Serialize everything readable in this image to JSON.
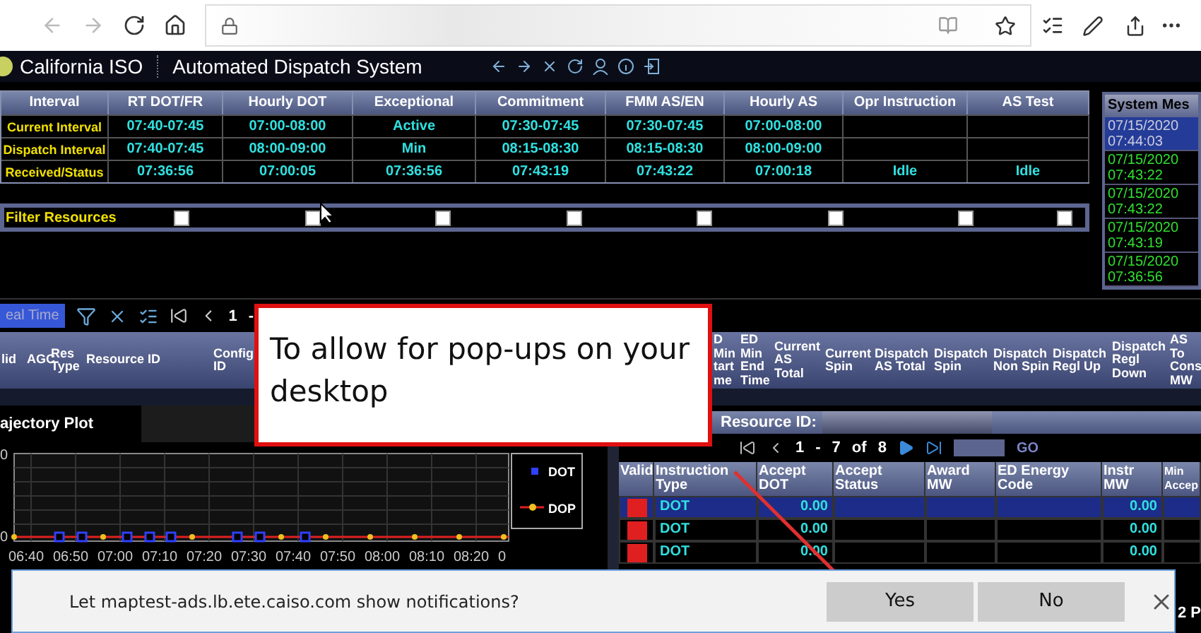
{
  "app": {
    "brand": "California ISO",
    "title": "Automated Dispatch System"
  },
  "interval_table": {
    "corner": "Interval",
    "columns": [
      "RT DOT/FR",
      "Hourly DOT",
      "Exceptional",
      "Commitment",
      "FMM AS/EN",
      "Hourly AS",
      "Opr Instruction",
      "AS Test"
    ],
    "rows": [
      {
        "label": "Current Interval",
        "cells": [
          "07:40-07:45",
          "07:00-08:00",
          "Active",
          "07:30-07:45",
          "07:30-07:45",
          "07:00-08:00"
        ]
      },
      {
        "label": "Dispatch Interval",
        "cells": [
          "07:40-07:45",
          "08:00-09:00",
          "Min",
          "08:15-08:30",
          "08:15-08:30",
          "08:00-09:00"
        ]
      },
      {
        "label": "Received/Status",
        "cells": [
          "07:36:56",
          "07:00:05",
          "07:36:56",
          "07:43:19",
          "07:43:22",
          "07:00:18",
          "Idle",
          "Idle"
        ]
      }
    ]
  },
  "filter": {
    "label": "Filter Resources",
    "checkboxes": [
      {
        "checked": false
      },
      {
        "checked": false
      },
      {
        "checked": false
      },
      {
        "checked": false
      },
      {
        "checked": false
      },
      {
        "checked": false
      },
      {
        "checked": false
      },
      {
        "checked": false
      }
    ]
  },
  "system_messages": {
    "title": "System Mes",
    "items": [
      {
        "date": "07/15/2020",
        "time": "07:44:03",
        "selected": true
      },
      {
        "date": "07/15/2020",
        "time": "07:43:22",
        "selected": false
      },
      {
        "date": "07/15/2020",
        "time": "07:43:22",
        "selected": false
      },
      {
        "date": "07/15/2020",
        "time": "07:43:19",
        "selected": false
      },
      {
        "date": "07/15/2020",
        "time": "07:36:56",
        "selected": false
      }
    ]
  },
  "grid_toolbar": {
    "tab": "eal Time",
    "page": "1",
    "separator": "-"
  },
  "grid_columns": [
    "lid",
    "AGC",
    "Res Type",
    "Resource ID",
    "Config ID",
    "D Min tart me",
    "ED Min End Time",
    "Current AS Total",
    "Current Spin",
    "Dispatch AS Total",
    "Dispatch Spin",
    "Dispatch Non Spin",
    "Dispatch Regl Up",
    "Dispatch Regl Down",
    "AS To Cons MW"
  ],
  "plot": {
    "title": "ajectory Plot",
    "y_labels": [
      "0",
      "0"
    ],
    "x_labels": [
      "06:40",
      "06:50",
      "07:00",
      "07:10",
      "07:20",
      "07:30",
      "07:40",
      "07:50",
      "08:00",
      "08:10",
      "08:20",
      "0"
    ],
    "legend": [
      {
        "label": "DOT",
        "kind": "square"
      },
      {
        "label": "DOP",
        "kind": "line"
      }
    ]
  },
  "resource_panel": {
    "label": "Resource ID:",
    "pager": {
      "from": "1",
      "separator": "-",
      "to": "7",
      "of": "of",
      "total": "8"
    },
    "go": "GO",
    "columns": [
      "Valid",
      "Instruction Type",
      "Accept DOT",
      "Accept Status",
      "Award MW",
      "ED Energy Code",
      "Instr MW",
      "Min Accep"
    ],
    "rows": [
      {
        "selected": true,
        "type": "DOT",
        "accept_dot": "0.00",
        "instr_mw": "0.00"
      },
      {
        "selected": false,
        "type": "DOT",
        "accept_dot": "0.00",
        "instr_mw": "0.00"
      },
      {
        "selected": false,
        "type": "DOT",
        "accept_dot": "0.00",
        "instr_mw": "0.00"
      }
    ]
  },
  "callout": {
    "text": "To allow for pop-ups on your desktop"
  },
  "notification": {
    "text": "Let maptest-ads.lb.ete.caiso.com show notifications?",
    "buttons": [
      "Yes",
      "No"
    ]
  },
  "corner_text": "2 P"
}
